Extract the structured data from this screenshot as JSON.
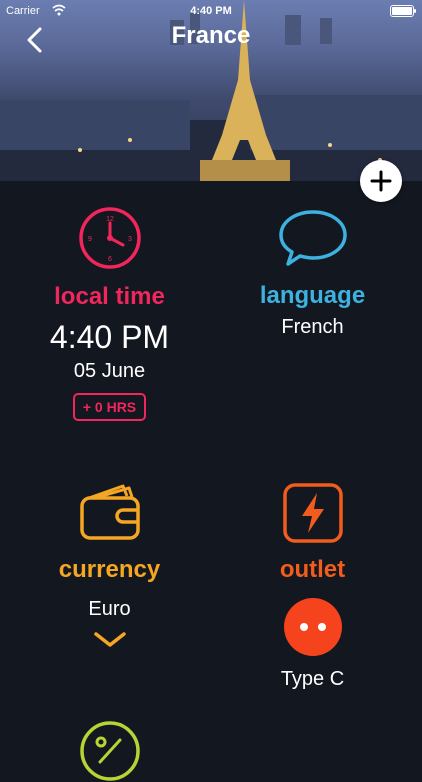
{
  "status_bar": {
    "carrier": "Carrier",
    "time": "4:40 PM"
  },
  "header": {
    "title": "France"
  },
  "local_time": {
    "label": "local time",
    "time": "4:40 PM",
    "date": "05 June",
    "offset": "+ 0 HRS"
  },
  "language": {
    "label": "language",
    "value": "French"
  },
  "currency": {
    "label": "currency",
    "value": "Euro"
  },
  "outlet": {
    "label": "outlet",
    "value": "Type C"
  },
  "colors": {
    "time": "#f0265c",
    "language": "#3db1e0",
    "currency": "#f5a623",
    "outlet": "#f25c1d",
    "tip": "#b8d334"
  }
}
